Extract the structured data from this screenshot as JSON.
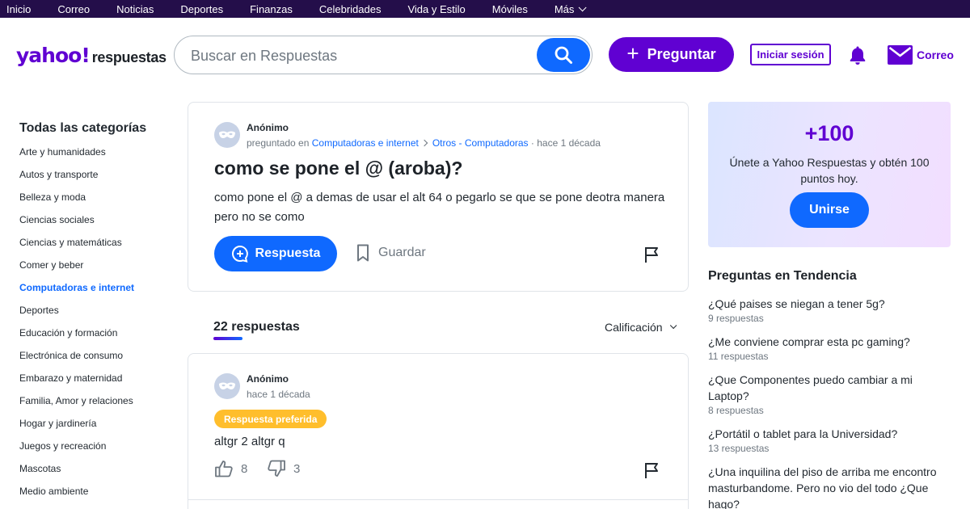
{
  "topnav": {
    "items": [
      "Inicio",
      "Correo",
      "Noticias",
      "Deportes",
      "Finanzas",
      "Celebridades",
      "Vida y Estilo",
      "Móviles",
      "Más"
    ]
  },
  "header": {
    "logo_brand": "yahoo!",
    "logo_product": "respuestas",
    "search_placeholder": "Buscar en Respuestas",
    "ask_label": "Preguntar",
    "login_label": "Iniciar sesión",
    "mail_label": "Correo"
  },
  "sidebar": {
    "title": "Todas las categorías",
    "active_index": 6,
    "items": [
      "Arte y humanidades",
      "Autos y transporte",
      "Belleza y moda",
      "Ciencias sociales",
      "Ciencias y matemáticas",
      "Comer y beber",
      "Computadoras e internet",
      "Deportes",
      "Educación y formación",
      "Electrónica de consumo",
      "Embarazo y maternidad",
      "Familia, Amor y relaciones",
      "Hogar y jardinería",
      "Juegos y recreación",
      "Mascotas",
      "Medio ambiente"
    ]
  },
  "question": {
    "author": "Anónimo",
    "asked_in": "preguntado en",
    "category": "Computadoras e internet",
    "subcategory": "Otros - Computadoras",
    "time": "· hace 1 década",
    "title": "como se pone el @ (aroba)?",
    "body": "como pone el @  a demas de usar el alt 64 o pegarlo se que se pone deotra manera pero no se como",
    "answer_label": "Respuesta",
    "save_label": "Guardar"
  },
  "answers": {
    "count_label": "22 respuestas",
    "sort_label": "Calificación",
    "items": [
      {
        "author": "Anónimo",
        "time": "hace 1 década",
        "badge": "Respuesta preferida",
        "text": "altgr 2 altgr q",
        "likes": "8",
        "dislikes": "3"
      }
    ]
  },
  "promo": {
    "points": "+100",
    "text": "Únete a Yahoo Respuestas y obtén 100 puntos hoy.",
    "join_label": "Unirse"
  },
  "trending": {
    "title": "Preguntas en Tendencia",
    "items": [
      {
        "q": "¿Qué paises se niegan a tener 5g?",
        "c": "9 respuestas"
      },
      {
        "q": "¿Me conviene comprar esta pc gaming?",
        "c": "11 respuestas"
      },
      {
        "q": "¿Que Componentes puedo cambiar a mi Laptop?",
        "c": "8 respuestas"
      },
      {
        "q": "¿Portátil o tablet para la Universidad?",
        "c": "13 respuestas"
      },
      {
        "q": "¿Una inquilina del piso de arriba me encontro masturbandome. Pero no vio del todo ¿Que hago?",
        "c": ""
      }
    ]
  },
  "colors": {
    "brand": "#6001d2",
    "primary": "#0f69ff",
    "topnav_bg": "#240e4a",
    "badge": "#ffbe2c"
  }
}
